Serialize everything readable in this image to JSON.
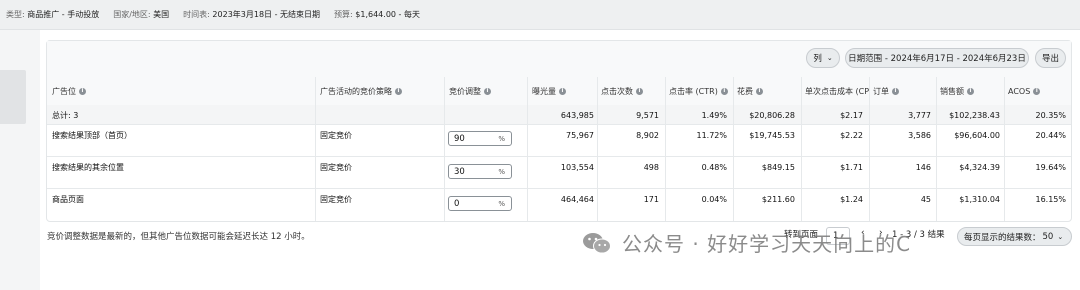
{
  "top_info": {
    "type_label": "类型:",
    "type_value": "商品推广 - 手动投放",
    "country_label": "国家/地区:",
    "country_value": "美国",
    "schedule_label": "时间表:",
    "schedule_value": "2023年3月18日 - 无结束日期",
    "budget_label": "预算:",
    "budget_value": "$1,644.00 - 每天"
  },
  "toolbar": {
    "columns_label": "列",
    "date_range_label": "日期范围 - 2024年6月17日 - 2024年6月23日",
    "export_label": "导出"
  },
  "table": {
    "headers": [
      "广告位",
      "广告活动的竞价策略",
      "竞价调整",
      "曝光量",
      "点击次数",
      "点击率 (CTR)",
      "花费",
      "单次点击成本 (CPC)",
      "订单",
      "销售额",
      "ACOS"
    ],
    "total": {
      "label": "总计: 3",
      "impressions": "643,985",
      "clicks": "9,571",
      "ctr": "1.49%",
      "spend": "$20,806.28",
      "cpc": "$2.17",
      "orders": "3,777",
      "sales": "$102,238.43",
      "acos": "20.35%"
    },
    "rows": [
      {
        "placement": "搜索结果顶部（首页）",
        "strategy": "固定竞价",
        "bid_adjust": "90",
        "pct": "%",
        "impressions": "75,967",
        "clicks": "8,902",
        "ctr": "11.72%",
        "spend": "$19,745.53",
        "cpc": "$2.22",
        "orders": "3,586",
        "sales": "$96,604.00",
        "acos": "20.44%"
      },
      {
        "placement": "搜索结果的其余位置",
        "strategy": "固定竞价",
        "bid_adjust": "30",
        "pct": "%",
        "impressions": "103,554",
        "clicks": "498",
        "ctr": "0.48%",
        "spend": "$849.15",
        "cpc": "$1.71",
        "orders": "146",
        "sales": "$4,324.39",
        "acos": "19.64%"
      },
      {
        "placement": "商品页面",
        "strategy": "固定竞价",
        "bid_adjust": "0",
        "pct": "%",
        "impressions": "464,464",
        "clicks": "171",
        "ctr": "0.04%",
        "spend": "$211.60",
        "cpc": "$1.24",
        "orders": "45",
        "sales": "$1,310.04",
        "acos": "16.15%"
      }
    ]
  },
  "footer": {
    "note": "竞价调整数据是最新的，但其他广告位数据可能会延迟长达 12 小时。",
    "goto_page_label": "转到页面",
    "page_value": "1",
    "range_text": "1 - 3 / 3 结果",
    "per_page_label": "每页显示的结果数：",
    "per_page_value": "50"
  },
  "watermark": {
    "text": "公众号 · 好好学习天天向上的C"
  }
}
